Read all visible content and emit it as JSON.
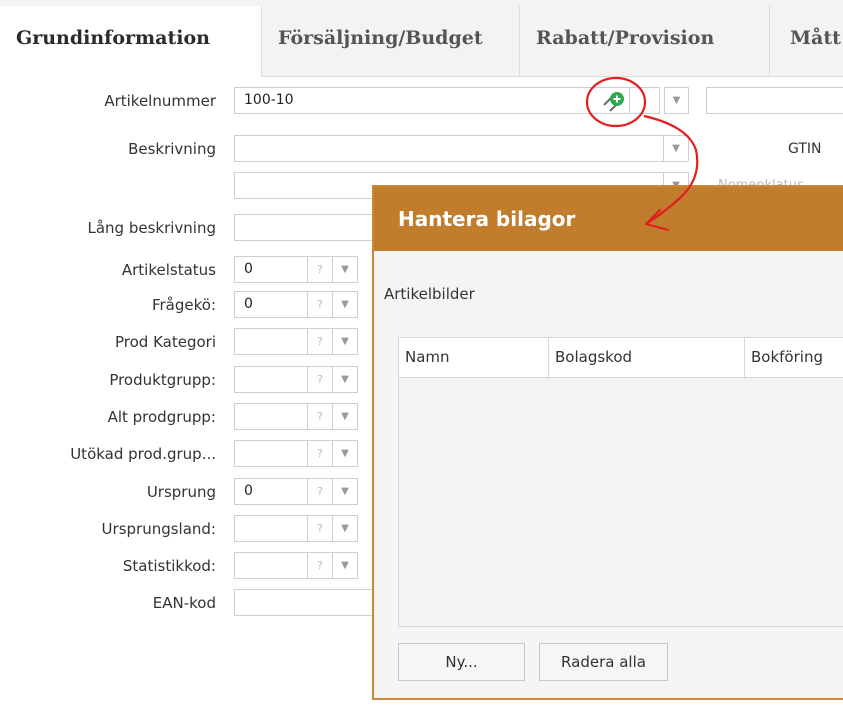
{
  "tabs": [
    {
      "label": "Grundinformation"
    },
    {
      "label": "Försäljning/Budget"
    },
    {
      "label": "Rabatt/Provision"
    },
    {
      "label": "Mått"
    }
  ],
  "form": {
    "artikelnummer": {
      "label": "Artikelnummer",
      "value": "100-10"
    },
    "beskrivning": {
      "label": "Beskrivning",
      "value": ""
    },
    "gtin_label": "GTIN",
    "nomenklatur_label": "Nomenklatur",
    "lang_beskrivning": {
      "label": "Lång beskrivning",
      "value": ""
    },
    "rows": [
      {
        "label": "Artikelstatus",
        "value": "0"
      },
      {
        "label": "Frågekö:",
        "value": "0"
      },
      {
        "label": "Prod Kategori",
        "value": ""
      },
      {
        "label": "Produktgrupp:",
        "value": ""
      },
      {
        "label": "Alt prodgrupp:",
        "value": ""
      },
      {
        "label": "Utökad prod.grup...",
        "value": ""
      },
      {
        "label": "Ursprung",
        "value": "0"
      },
      {
        "label": "Ursprungsland:",
        "value": ""
      },
      {
        "label": "Statistikkod:",
        "value": ""
      }
    ],
    "ean": {
      "label": "EAN-kod",
      "value": ""
    },
    "q_mark": "?",
    "dropdown_glyph": "▼"
  },
  "dialog": {
    "title": "Hantera bilagor",
    "section_label": "Artikelbilder",
    "columns": [
      "Namn",
      "Bolagskod",
      "Bokföring"
    ],
    "new_button": "Ny...",
    "delete_all_button": "Radera alla"
  },
  "colors": {
    "dialog_header": "#c27d2c",
    "annotation": "#e02020",
    "add_icon": "#2fa84f"
  }
}
